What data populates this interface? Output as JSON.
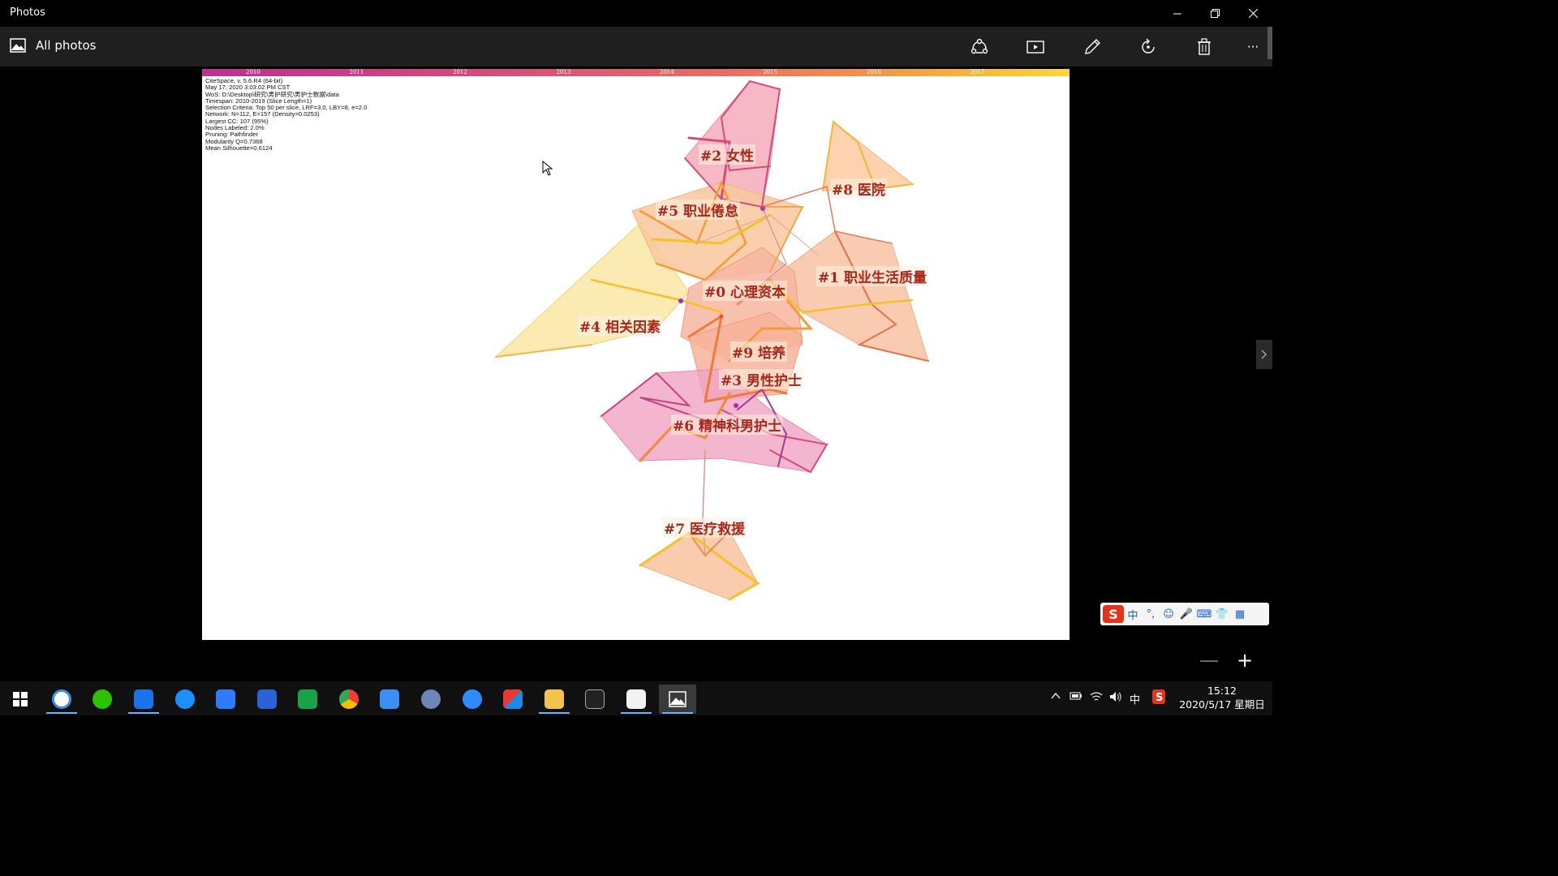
{
  "window": {
    "app_title": "Photos",
    "minimize_icon": "minimize-icon",
    "restore_icon": "restore-icon",
    "close_icon": "close-icon"
  },
  "toolbar": {
    "breadcrumb": "All photos",
    "more_label": "···"
  },
  "image": {
    "years": [
      "2010",
      "2011",
      "2012",
      "2013",
      "2014",
      "2015",
      "2016",
      "2017"
    ],
    "info_lines": [
      "CiteSpace, v. 5.6.R4 (64-bit)",
      "May 17, 2020 3:03:02 PM CST",
      "WoS: D:\\Desktop\\研究\\男护研究\\男护士数据\\data",
      "Timespan: 2010-2019 (Slice Length=1)",
      "Selection Criteria: Top 50 per slice, LRF=3.0, LBY=8, e=2.0",
      "Network: N=112, E=157 (Density=0.0253)",
      "Largest CC: 107 (95%)",
      "Nodes Labeled: 2.0%",
      "Pruning: Pathfinder",
      "Modularity Q=0.7368",
      "Mean Silhouette=0.6124"
    ],
    "clusters": [
      {
        "label": "#2 女性"
      },
      {
        "label": "#8 医院"
      },
      {
        "label": "#5 职业倦怠"
      },
      {
        "label": "#1 职业生活质量"
      },
      {
        "label": "#0 心理资本"
      },
      {
        "label": "#4 相关因素"
      },
      {
        "label": "#9 培养"
      },
      {
        "label": "#3 男性护士"
      },
      {
        "label": "#6 精神科男护士"
      },
      {
        "label": "#7 医疗救援"
      }
    ]
  },
  "zoom": {
    "out": "—",
    "in": "+"
  },
  "ime": {
    "items": [
      "中",
      "°,",
      "☺",
      "🎤",
      "⌨",
      "👕",
      "▦"
    ],
    "logo": "S"
  },
  "taskbar": {
    "tray_lang": "中",
    "time": "15:12",
    "date": "2020/5/17 星期日"
  },
  "colors": {
    "accent": "#6fb1ff",
    "cluster_label": "#a8261a"
  }
}
